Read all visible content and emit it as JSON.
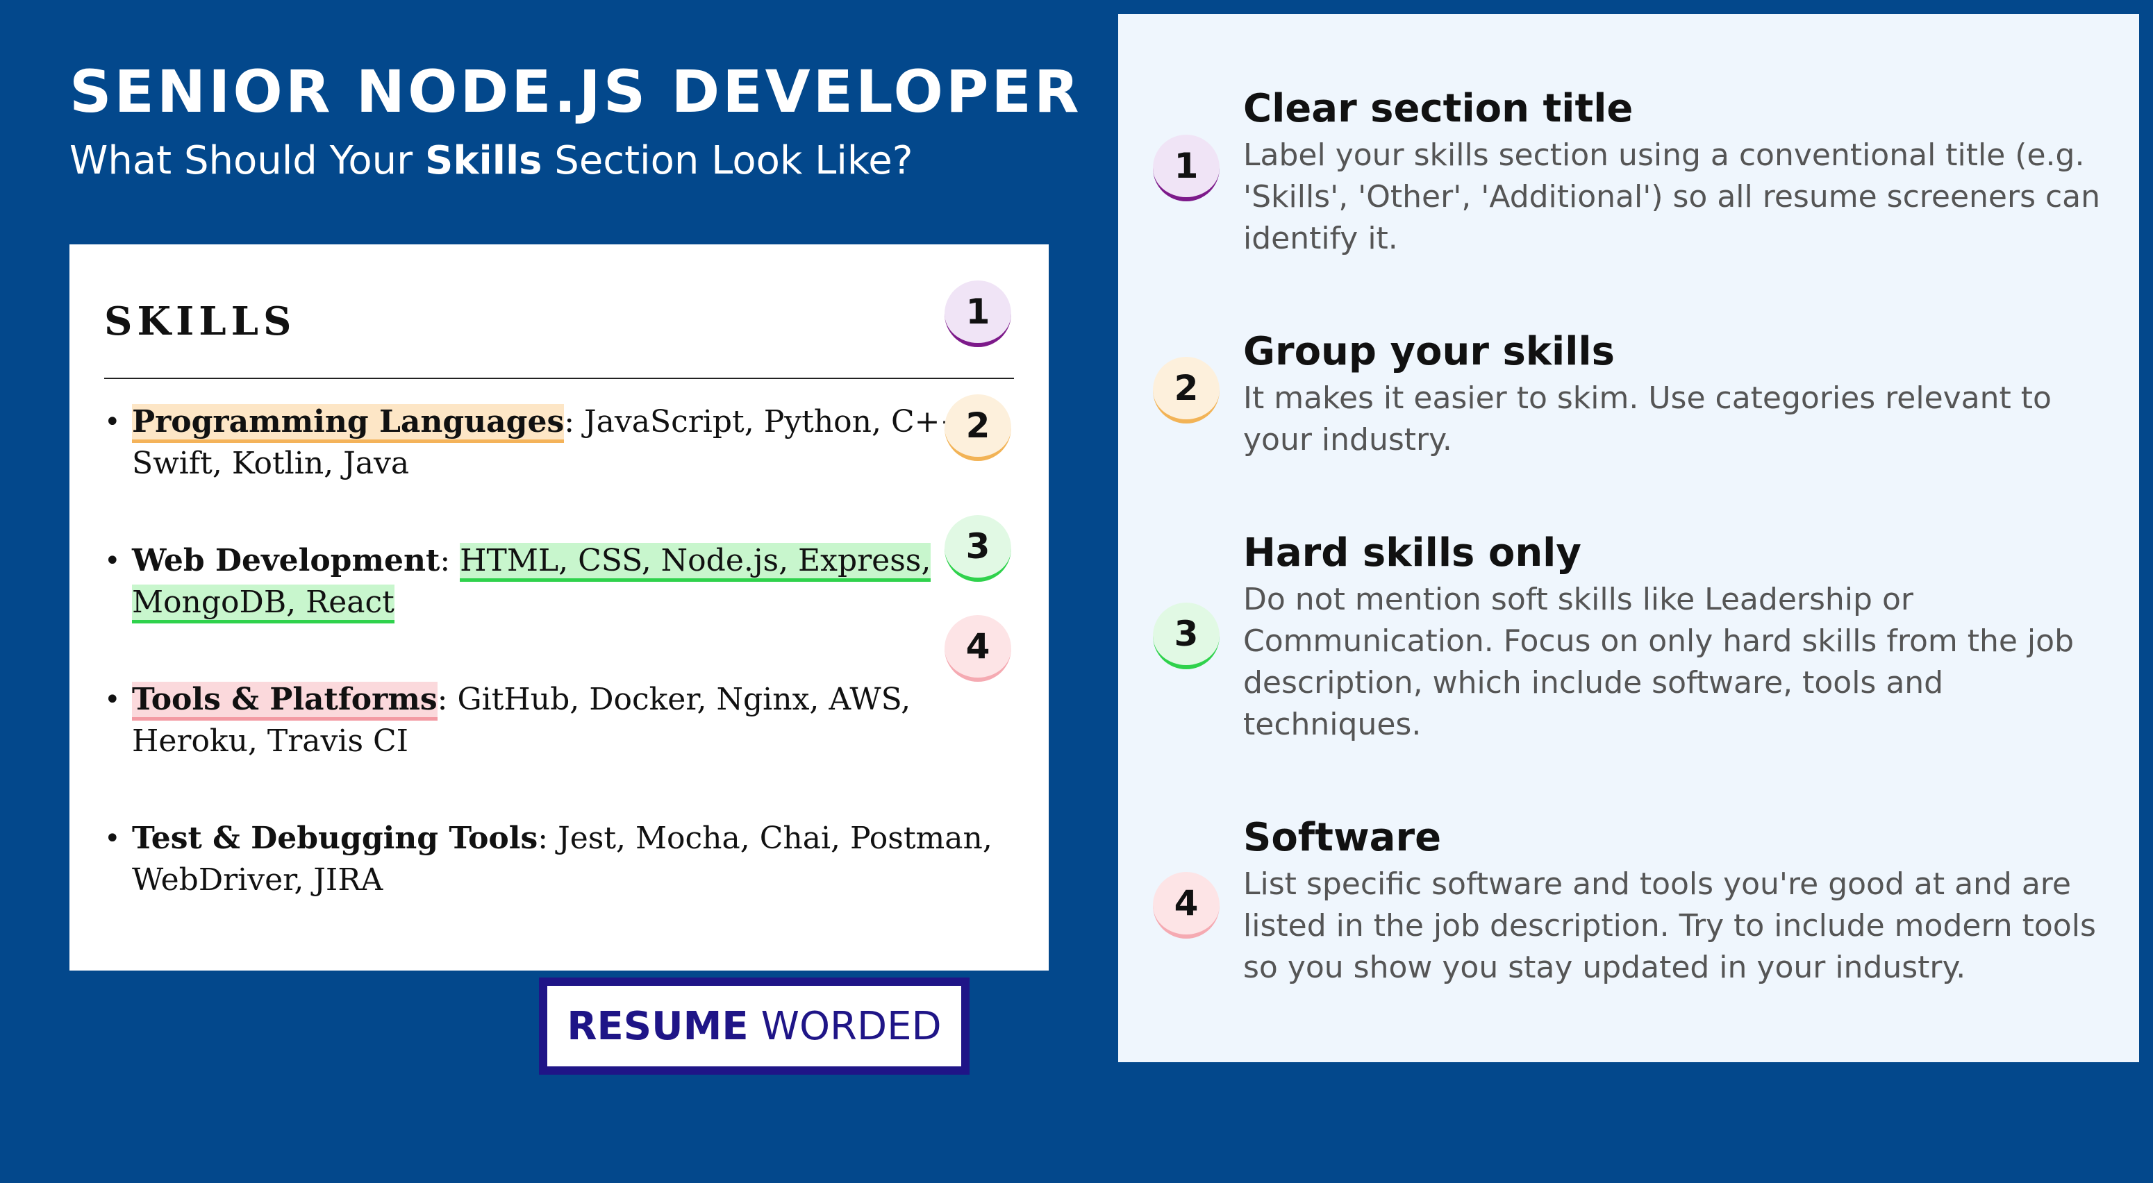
{
  "header": {
    "title": "SENIOR NODE.JS DEVELOPER",
    "subtitle_pre": "What Should Your ",
    "subtitle_bold": "Skills",
    "subtitle_post": " Section Look Like?"
  },
  "resume": {
    "heading": "SKILLS",
    "items": [
      {
        "category": "Programming Languages",
        "separator": ": ",
        "values": "JavaScript, Python, C++, Swift, Kotlin, Java"
      },
      {
        "category": "Web Development",
        "separator": ": ",
        "values": "HTML, CSS, Node.js, Express, MongoDB, React"
      },
      {
        "category": "Tools & Platforms",
        "separator": ": ",
        "values": "GitHub, Docker, Nginx, AWS, Heroku, Travis CI"
      },
      {
        "category": "Test & Debugging Tools",
        "separator": ": ",
        "values": "Jest, Mocha, Chai, Postman, WebDriver, JIRA"
      }
    ],
    "badges": [
      "1",
      "2",
      "3",
      "4"
    ]
  },
  "logo": {
    "strong": "RESUME",
    "light": "WORDED"
  },
  "tips": [
    {
      "number": "1",
      "title": "Clear section title",
      "description": "Label your skills section using a conventional title (e.g. 'Skills', 'Other', 'Additional') so all resume screeners can identify it."
    },
    {
      "number": "2",
      "title": "Group your skills",
      "description": "It makes it easier to skim. Use categories relevant to your industry."
    },
    {
      "number": "3",
      "title": "Hard skills only",
      "description": "Do not mention soft skills like Leadership or Communication. Focus on only hard skills from the job description, which include software, tools and techniques."
    },
    {
      "number": "4",
      "title": "Software",
      "description": "List specific software and tools you're good at and are listed in the job description. Try to include modern tools so you show you stay updated in your industry."
    }
  ],
  "colors": {
    "background": "#03488c",
    "panel": "#eff6fd",
    "badge1": "#7d1a8a",
    "badge2": "#f2b356",
    "badge3": "#2fd24c",
    "badge4": "#f5aab2",
    "logo": "#1f1587"
  }
}
